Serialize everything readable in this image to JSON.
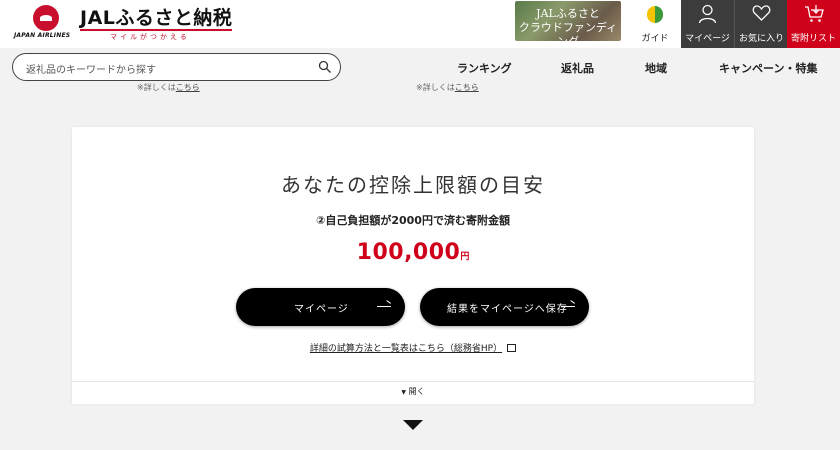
{
  "header": {
    "airline_text": "JAPAN AIRLINES",
    "brand_title": "JALふるさと納税",
    "brand_sub": "マイルがつかえる",
    "crowd_line1": "JALふるさと",
    "crowd_line2": "クラウドファンディング",
    "guide_label": "ガイド",
    "mypage_label": "マイページ",
    "favorites_label": "お気に入り",
    "cart_label": "寄附リスト"
  },
  "nav": {
    "search_placeholder": "返礼品のキーワードから探す",
    "items": [
      "ランキング",
      "返礼品",
      "地域",
      "キャンペーン・特集"
    ]
  },
  "notes": {
    "left_prefix": "※詳しくは",
    "left_link": "こちら",
    "right_prefix": "※詳しくは",
    "right_link": "こちら"
  },
  "card": {
    "title": "あなたの控除上限額の目安",
    "subtitle": "②自己負担額が2000円で済む寄附金額",
    "amount": "100,000",
    "amount_unit": "円",
    "btn_mypage": "マイページ",
    "btn_save": "結果をマイページへ保存",
    "detail_link": "詳細の試算方法と一覧表はこちら（総務省HP）",
    "open_label": "開く"
  },
  "colors": {
    "accent_red": "#d0021b",
    "dark_button": "#3c3c3c"
  },
  "icons": [
    "jal-crane-logo",
    "beginner-leaf-icon",
    "person-icon",
    "heart-icon",
    "cart-icon",
    "search-icon",
    "arrow-right-icon",
    "external-link-icon",
    "caret-down-icon",
    "chevron-down-icon"
  ]
}
